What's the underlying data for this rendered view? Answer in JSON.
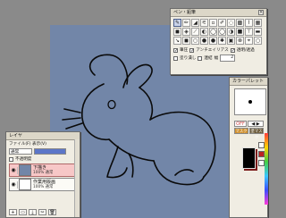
{
  "canvas": {
    "background": "#7286a8",
    "line_color": "#0a0a0a"
  },
  "pen_panel": {
    "title": "ペン・鉛筆",
    "close": "×",
    "tools": [
      "✎",
      "✏",
      "◢",
      "⚟",
      "▫",
      "✐",
      "◌",
      "▩",
      "⌇",
      "▦",
      "◼",
      "◈",
      "⟋",
      "◐",
      "◯",
      "◯",
      "◑",
      "■",
      "⊤",
      "▬",
      "↘",
      "◼",
      "○",
      "●",
      "●",
      "✱",
      "▣",
      "⊗",
      "⌖",
      "○"
    ],
    "opt1": {
      "pressure": "筆圧",
      "aa": "アンチエイリアス",
      "auto": "透明/透過"
    },
    "opt2": {
      "fill": "塗り潰し",
      "flatten": "連結",
      "size_label": "幅",
      "size_value": "2"
    }
  },
  "color_panel": {
    "title": "カラーパレット",
    "off": "OFF",
    "nav": "◀ ▶",
    "mask_a": "マスク",
    "mask_b": "塗マスク",
    "main_color": "#000000",
    "shadow_color": "#7a1919"
  },
  "layer_panel": {
    "title": "レイヤ",
    "menu": "ファイル(F)  表示(V)",
    "mode": "通常",
    "opacity_label": "不透明度",
    "layers": [
      {
        "name": "下描き",
        "mode": "100% 通常",
        "eye": "👁",
        "selected": true
      },
      {
        "name": "作業用版画",
        "mode": "100% 通常",
        "eye": "👁",
        "selected": false
      }
    ],
    "footer": [
      "+",
      "▭",
      "⤓",
      "✂",
      "🗑"
    ]
  }
}
